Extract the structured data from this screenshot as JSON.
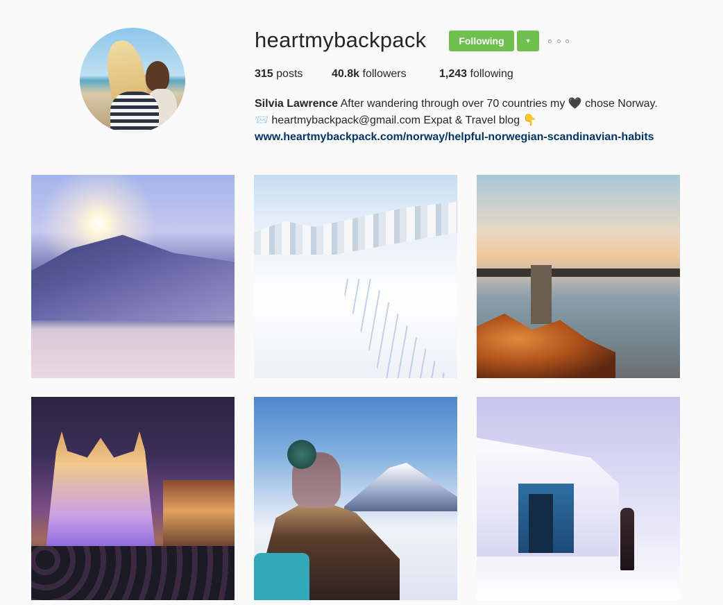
{
  "profile": {
    "username": "heartmybackpack",
    "following_label": "Following",
    "dropdown_glyph": "▾",
    "more_icon": "ellipsis-icon",
    "stats": {
      "posts_count": "315",
      "posts_label": "posts",
      "followers_count": "40.8k",
      "followers_label": "followers",
      "following_count": "1,243",
      "following_label": "following"
    },
    "bio": {
      "name": "Silvia Lawrence",
      "line1_text": " After wandering through over 70 countries my ",
      "heart_glyph": "🖤",
      "line1_end": " chose Norway.",
      "mail_glyph": "📨",
      "line2_text": " heartmybackpack@gmail.com Expat & Travel blog ",
      "pointer_glyph": "👇",
      "link": "www.heartmybackpack.com/norway/helpful-norwegian-scandinavian-habits"
    }
  },
  "colors": {
    "follow_green": "#70c050",
    "link_blue": "#003569",
    "background": "#fafafa"
  },
  "posts": [
    {
      "icon": "photo-snowy-mountain-sunburst"
    },
    {
      "icon": "photo-ski-track-snow-forest"
    },
    {
      "icon": "photo-chain-bridge-sunset"
    },
    {
      "icon": "photo-christmas-market-basilica"
    },
    {
      "icon": "photo-woman-mountain-view"
    },
    {
      "icon": "photo-snow-covered-hut"
    }
  ]
}
